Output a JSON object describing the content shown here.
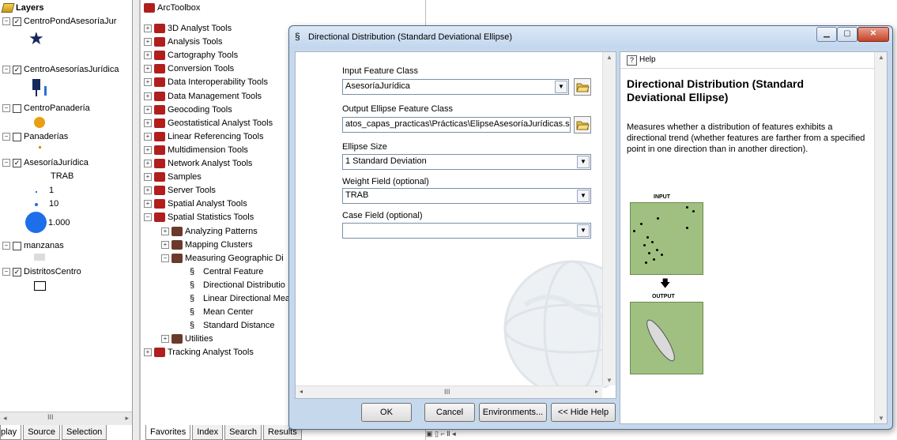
{
  "toc": {
    "title": "Layers",
    "layers": [
      {
        "name": "CentroPondAsesoríaJur",
        "checked": true
      },
      {
        "name": "CentroAsesoríasJurídica",
        "checked": true
      },
      {
        "name": "CentroPanadería",
        "checked": false
      },
      {
        "name": "Panaderías",
        "checked": false
      },
      {
        "name": "AsesoríaJurídica",
        "checked": true
      },
      {
        "name": "manzanas",
        "checked": false
      },
      {
        "name": "DistritosCentro",
        "checked": true
      }
    ],
    "legend_field": "TRAB",
    "legend_values": [
      "1",
      "10",
      "1.000"
    ],
    "scroll_label": "III",
    "tabs": [
      "play",
      "Source",
      "Selection"
    ]
  },
  "toolbox": {
    "root": "ArcToolbox",
    "toolsets": [
      "3D Analyst Tools",
      "Analysis Tools",
      "Cartography Tools",
      "Conversion Tools",
      "Data Interoperability Tools",
      "Data Management Tools",
      "Geocoding Tools",
      "Geostatistical Analyst Tools",
      "Linear Referencing Tools",
      "Multidimension Tools",
      "Network Analyst Tools",
      "Samples",
      "Server Tools",
      "Spatial Analyst Tools",
      "Spatial Statistics Tools"
    ],
    "spatial_stats_children": [
      "Analyzing Patterns",
      "Mapping Clusters",
      "Measuring Geographic Di"
    ],
    "measuring_tools": [
      "Central Feature",
      "Directional Distributio",
      "Linear Directional Mea",
      "Mean Center",
      "Standard Distance"
    ],
    "utilities": "Utilities",
    "tracking": "Tracking Analyst Tools",
    "tabs": [
      "Favorites",
      "Index",
      "Search",
      "Results"
    ]
  },
  "dialog": {
    "title": "Directional Distribution (Standard Deviational Ellipse)",
    "fields": {
      "input_label": "Input Feature Class",
      "input_value": "AsesoríaJurídica",
      "output_label": "Output Ellipse Feature Class",
      "output_value": "atos_capas_practicas\\Prácticas\\ElipseAsesoríaJurídicas.shp",
      "size_label": "Ellipse Size",
      "size_value": "1 Standard Deviation",
      "weight_label": "Weight Field (optional)",
      "weight_value": "TRAB",
      "case_label": "Case Field (optional)",
      "case_value": ""
    },
    "buttons": {
      "ok": "OK",
      "cancel": "Cancel",
      "env": "Environments...",
      "hide": "<< Hide Help"
    },
    "hscroll_label": "III",
    "help": {
      "tab": "Help",
      "heading": "Directional Distribution (Standard Deviational Ellipse)",
      "body": "Measures whether a distribution of features exhibits a directional trend (whether features are farther from a specified point in one direction than in another direction).",
      "input_label": "INPUT",
      "output_label": "OUTPUT"
    },
    "colors": {
      "panel": "#9fc080",
      "title_bg": "#c2d6ee",
      "close": "#c54327"
    }
  }
}
